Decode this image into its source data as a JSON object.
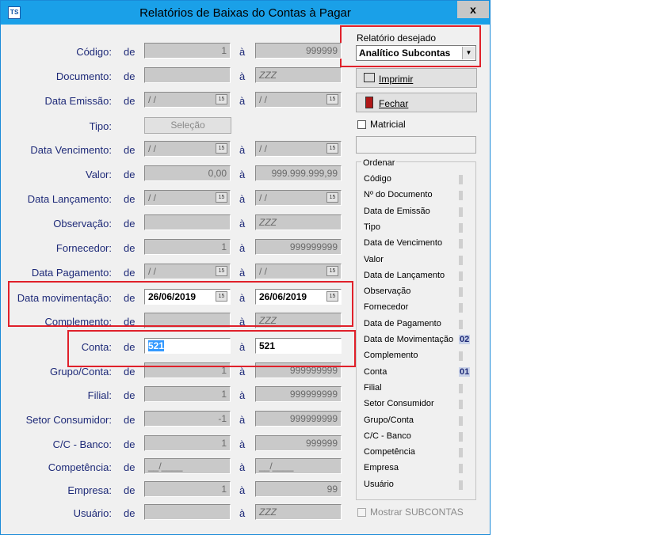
{
  "window": {
    "title": "Relatórios de Baixas do Contas à Pagar",
    "close": "x",
    "app_icon": "TS"
  },
  "labels": {
    "de": "de",
    "a": "à"
  },
  "rows": [
    {
      "label": "Código:",
      "from": "1",
      "to": "999999"
    },
    {
      "label": "Documento:",
      "from": "",
      "to": "ZZZ"
    },
    {
      "label": "Data Emissão:",
      "from": "/ /",
      "to": "/ /"
    },
    {
      "label": "Tipo:",
      "button": "Seleção"
    },
    {
      "label": "Data Vencimento:",
      "from": "/ /",
      "to": "/ /"
    },
    {
      "label": "Valor:",
      "from": "0,00",
      "to": "999.999.999,99"
    },
    {
      "label": "Data Lançamento:",
      "from": "/ /",
      "to": "/ /"
    },
    {
      "label": "Observação:",
      "from": "",
      "to": "ZZZ"
    },
    {
      "label": "Fornecedor:",
      "from": "1",
      "to": "999999999"
    },
    {
      "label": "Data Pagamento:",
      "from": "/ /",
      "to": "/ /"
    },
    {
      "label": "Data movimentação:",
      "from": "26/06/2019",
      "to": "26/06/2019"
    },
    {
      "label": "Complemento:",
      "from": "",
      "to": "ZZZ"
    },
    {
      "label": "Conta:",
      "from": "521",
      "to": "521"
    },
    {
      "label": "Grupo/Conta:",
      "from": "1",
      "to": "999999999"
    },
    {
      "label": "Filial:",
      "from": "1",
      "to": "999999999"
    },
    {
      "label": "Setor Consumidor:",
      "from": "-1",
      "to": "999999999"
    },
    {
      "label": "C/C - Banco:",
      "from": "1",
      "to": "999999"
    },
    {
      "label": "Competência:",
      "from": "__/____",
      "to": "__/____"
    },
    {
      "label": "Empresa:",
      "from": "1",
      "to": "99"
    },
    {
      "label": "Usuário:",
      "from": "",
      "to": "ZZZ"
    }
  ],
  "calendar_icon_text": "15",
  "report": {
    "label": "Relatório desejado",
    "selected": "Analítico Subcontas"
  },
  "buttons": {
    "print": "Imprimir",
    "close": "Fechar"
  },
  "matricial": "Matricial",
  "order": {
    "title": "Ordenar",
    "items": [
      {
        "label": "Código",
        "num": ""
      },
      {
        "label": "Nº do Documento",
        "num": ""
      },
      {
        "label": "Data de Emissão",
        "num": ""
      },
      {
        "label": "Tipo",
        "num": ""
      },
      {
        "label": "Data de Vencimento",
        "num": ""
      },
      {
        "label": "Valor",
        "num": ""
      },
      {
        "label": "Data de Lançamento",
        "num": ""
      },
      {
        "label": "Observação",
        "num": ""
      },
      {
        "label": "Fornecedor",
        "num": ""
      },
      {
        "label": "Data de Pagamento",
        "num": ""
      },
      {
        "label": "Data de Movimentação",
        "num": "02"
      },
      {
        "label": "Complemento",
        "num": ""
      },
      {
        "label": "Conta",
        "num": "01"
      },
      {
        "label": "Filial",
        "num": ""
      },
      {
        "label": "Setor Consumidor",
        "num": ""
      },
      {
        "label": "Grupo/Conta",
        "num": ""
      },
      {
        "label": "C/C - Banco",
        "num": ""
      },
      {
        "label": "Competência",
        "num": ""
      },
      {
        "label": "Empresa",
        "num": ""
      },
      {
        "label": "Usuário",
        "num": ""
      }
    ]
  },
  "show_subcontas": "Mostrar SUBCONTAS"
}
